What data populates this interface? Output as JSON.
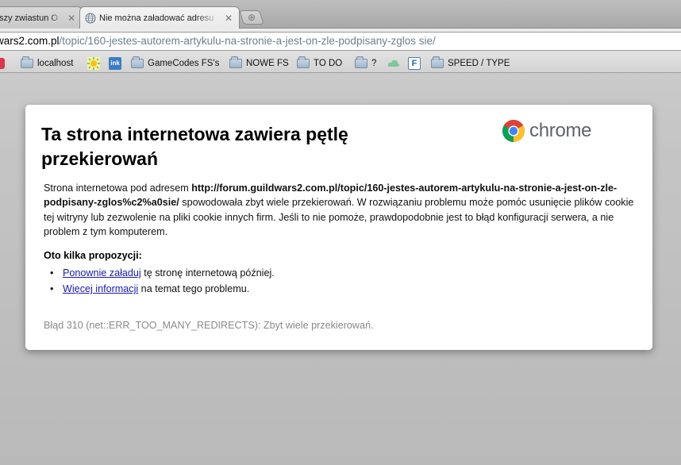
{
  "tabs": [
    {
      "title": "szy zwiastun O",
      "active": false
    },
    {
      "title": "Nie można załadować adresu",
      "active": true
    }
  ],
  "omnibox": {
    "host": "wars2.com.pl",
    "path": "/topic/160-jestes-autorem-artykulu-na-stronie-a-jest-on-zle-podpisany-zglos sie/"
  },
  "bookmarks": [
    {
      "label": "localhost",
      "icon": "folder-icon"
    },
    {
      "label": "",
      "icon": "sun-favicon"
    },
    {
      "label": "",
      "icon": "ink-favicon",
      "badge": "ink"
    },
    {
      "label": "GameCodes FS's",
      "icon": "folder-icon"
    },
    {
      "label": "NOWE FS",
      "icon": "folder-icon"
    },
    {
      "label": "TO DO",
      "icon": "folder-icon"
    },
    {
      "label": "?",
      "icon": "folder-icon"
    },
    {
      "label": "",
      "icon": "cloud-favicon"
    },
    {
      "label": "",
      "icon": "f-favicon",
      "badge": "F"
    },
    {
      "label": "SPEED / TYPE",
      "icon": "folder-icon"
    }
  ],
  "error": {
    "heading_line1": "Ta strona internetowa zawiera pętlę",
    "heading_line2": "przekierowań",
    "logo_text": "chrome",
    "body_prefix": "Strona internetowa pod adresem ",
    "url": "http://forum.guildwars2.com.pl/topic/160-jestes-autorem-artykulu-na-stronie-a-jest-on-zle-podpisany-zglos%c2%a0sie/",
    "body_suffix": " spowodowała zbyt wiele przekierowań. W rozwiązaniu problemu może pomóc usunięcie plików cookie tej witryny lub zezwolenie na pliki cookie innych firm. Jeśli to nie pomoże, prawdopodobnie jest to błąd konfiguracji serwera, a nie problem z tym komputerem.",
    "suggestions_title": "Oto kilka propozycji:",
    "suggestions": [
      {
        "link": "Ponownie załaduj",
        "rest": " tę stronę internetową później."
      },
      {
        "link": "Więcej informacji",
        "rest": " na temat tego problemu."
      }
    ],
    "error_code": "Błąd 310 (net::ERR_TOO_MANY_REDIRECTS): Zbyt wiele przekierowań."
  },
  "colors": {
    "link": "#1a1ab0",
    "error_code_text": "#8a8a8a",
    "background": "#c4c4c4"
  }
}
